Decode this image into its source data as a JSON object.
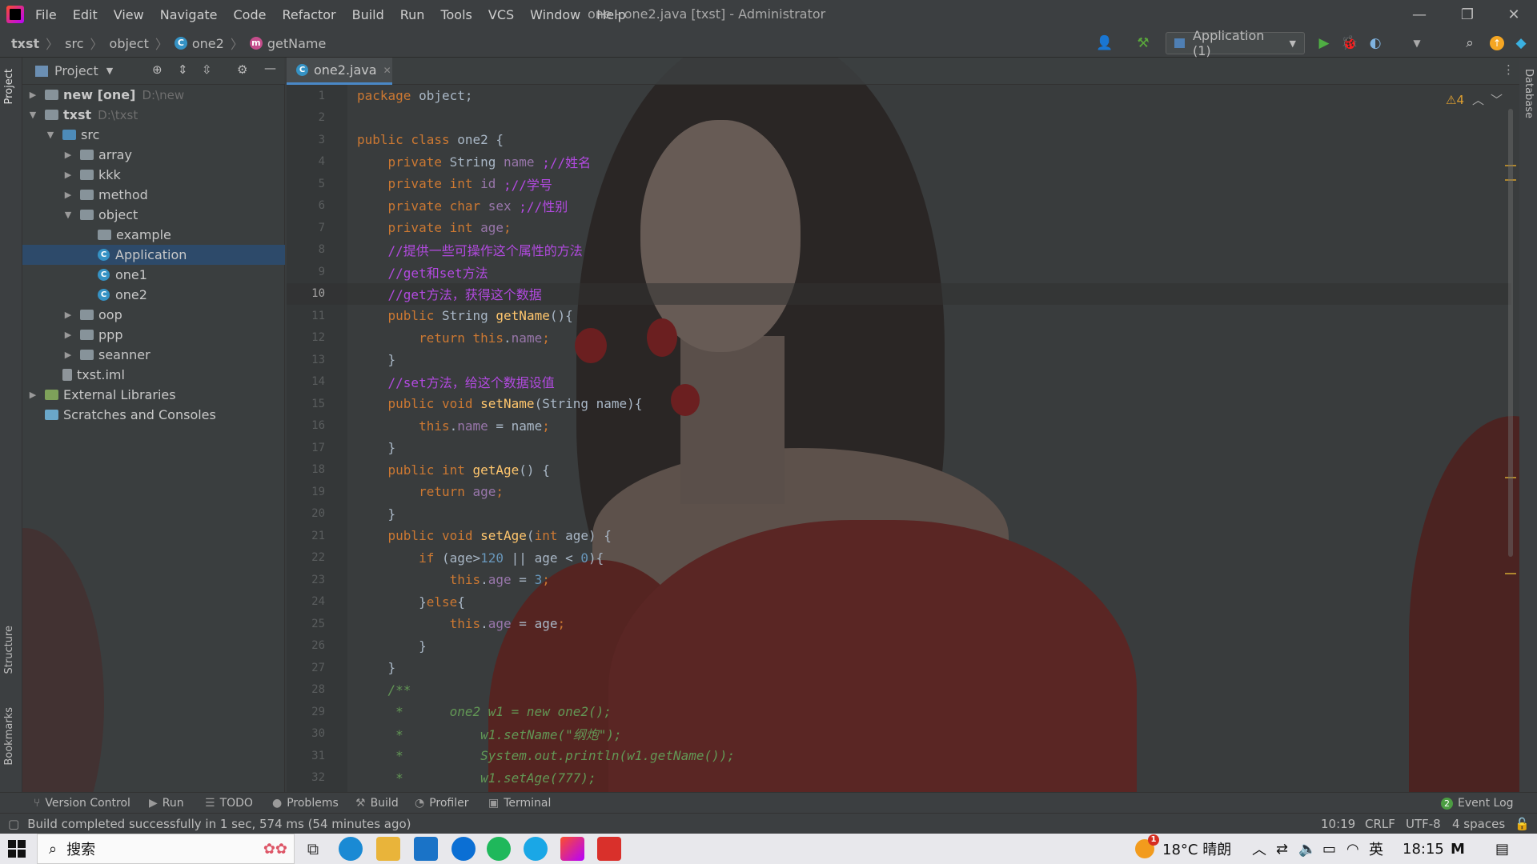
{
  "window": {
    "menu": [
      "File",
      "Edit",
      "View",
      "Navigate",
      "Code",
      "Refactor",
      "Build",
      "Run",
      "Tools",
      "VCS",
      "Window",
      "Help"
    ],
    "title": "one - one2.java [txst] - Administrator"
  },
  "breadcrumb": [
    "txst",
    "src",
    "object",
    "one2",
    "getName"
  ],
  "run_config": "Application (1)",
  "project_panel": {
    "title": "Project",
    "tree": [
      {
        "label": "new [one]",
        "hint": "D:\\new",
        "depth": 0,
        "arrow": "right",
        "icon": "folder"
      },
      {
        "label": "txst",
        "hint": "D:\\txst",
        "depth": 0,
        "arrow": "down",
        "icon": "folder"
      },
      {
        "label": "src",
        "hint": "",
        "depth": 1,
        "arrow": "down",
        "icon": "src"
      },
      {
        "label": "array",
        "hint": "",
        "depth": 2,
        "arrow": "right",
        "icon": "folder"
      },
      {
        "label": "kkk",
        "hint": "",
        "depth": 2,
        "arrow": "right",
        "icon": "folder"
      },
      {
        "label": "method",
        "hint": "",
        "depth": 2,
        "arrow": "right",
        "icon": "folder"
      },
      {
        "label": "object",
        "hint": "",
        "depth": 2,
        "arrow": "down",
        "icon": "folder"
      },
      {
        "label": "example",
        "hint": "",
        "depth": 3,
        "arrow": "",
        "icon": "folder"
      },
      {
        "label": "Application",
        "hint": "",
        "depth": 3,
        "arrow": "",
        "icon": "class",
        "selected": true
      },
      {
        "label": "one1",
        "hint": "",
        "depth": 3,
        "arrow": "",
        "icon": "class"
      },
      {
        "label": "one2",
        "hint": "",
        "depth": 3,
        "arrow": "",
        "icon": "class"
      },
      {
        "label": "oop",
        "hint": "",
        "depth": 2,
        "arrow": "right",
        "icon": "folder"
      },
      {
        "label": "ppp",
        "hint": "",
        "depth": 2,
        "arrow": "right",
        "icon": "folder"
      },
      {
        "label": "seanner",
        "hint": "",
        "depth": 2,
        "arrow": "right",
        "icon": "folder"
      },
      {
        "label": "txst.iml",
        "hint": "",
        "depth": 1,
        "arrow": "",
        "icon": "file"
      },
      {
        "label": "External Libraries",
        "hint": "",
        "depth": 0,
        "arrow": "right",
        "icon": "lib"
      },
      {
        "label": "Scratches and Consoles",
        "hint": "",
        "depth": 0,
        "arrow": "",
        "icon": "scratch"
      }
    ]
  },
  "editor": {
    "tab": "one2.java",
    "warnings": "4",
    "current_line": 10,
    "lines": [
      {
        "n": 1,
        "tokens": [
          [
            "kw",
            "package "
          ],
          [
            "txt",
            "object;"
          ]
        ]
      },
      {
        "n": 2,
        "tokens": []
      },
      {
        "n": 3,
        "tokens": [
          [
            "kw",
            "public class "
          ],
          [
            "txt",
            "one2 {"
          ]
        ]
      },
      {
        "n": 4,
        "tokens": [
          [
            "txt",
            "    "
          ],
          [
            "kw",
            "private "
          ],
          [
            "txt",
            "String "
          ],
          [
            "fd",
            "name "
          ],
          [
            "cm",
            ";//姓名"
          ]
        ]
      },
      {
        "n": 5,
        "tokens": [
          [
            "txt",
            "    "
          ],
          [
            "kw",
            "private int "
          ],
          [
            "fd",
            "id "
          ],
          [
            "cm",
            ";//学号"
          ]
        ]
      },
      {
        "n": 6,
        "tokens": [
          [
            "txt",
            "    "
          ],
          [
            "kw",
            "private char "
          ],
          [
            "fd",
            "sex "
          ],
          [
            "cm",
            ";//性别"
          ]
        ]
      },
      {
        "n": 7,
        "tokens": [
          [
            "txt",
            "    "
          ],
          [
            "kw",
            "private int "
          ],
          [
            "fd",
            "age"
          ],
          [
            "kw",
            ";"
          ]
        ]
      },
      {
        "n": 8,
        "tokens": [
          [
            "txt",
            "    "
          ],
          [
            "cm",
            "//提供一些可操作这个属性的方法"
          ]
        ]
      },
      {
        "n": 9,
        "tokens": [
          [
            "txt",
            "    "
          ],
          [
            "cm",
            "//get和set方法"
          ]
        ]
      },
      {
        "n": 10,
        "tokens": [
          [
            "txt",
            "    "
          ],
          [
            "cm",
            "//get方法，获得这个数据"
          ]
        ]
      },
      {
        "n": 11,
        "tokens": [
          [
            "txt",
            "    "
          ],
          [
            "kw",
            "public "
          ],
          [
            "txt",
            "String "
          ],
          [
            "fn",
            "getName"
          ],
          [
            "txt",
            "(){"
          ]
        ]
      },
      {
        "n": 12,
        "tokens": [
          [
            "txt",
            "        "
          ],
          [
            "kw",
            "return this"
          ],
          [
            "txt",
            "."
          ],
          [
            "fd",
            "name"
          ],
          [
            "kw",
            ";"
          ]
        ]
      },
      {
        "n": 13,
        "tokens": [
          [
            "txt",
            "    }"
          ]
        ]
      },
      {
        "n": 14,
        "tokens": [
          [
            "txt",
            "    "
          ],
          [
            "cm",
            "//set方法，给这个数据设值"
          ]
        ]
      },
      {
        "n": 15,
        "tokens": [
          [
            "txt",
            "    "
          ],
          [
            "kw",
            "public void "
          ],
          [
            "fn",
            "setName"
          ],
          [
            "txt",
            "(String name){"
          ]
        ]
      },
      {
        "n": 16,
        "tokens": [
          [
            "txt",
            "        "
          ],
          [
            "kw",
            "this"
          ],
          [
            "txt",
            "."
          ],
          [
            "fd",
            "name"
          ],
          [
            "txt",
            " = name"
          ],
          [
            "kw",
            ";"
          ]
        ]
      },
      {
        "n": 17,
        "tokens": [
          [
            "txt",
            "    }"
          ]
        ]
      },
      {
        "n": 18,
        "tokens": [
          [
            "txt",
            "    "
          ],
          [
            "kw",
            "public int "
          ],
          [
            "fn",
            "getAge"
          ],
          [
            "txt",
            "() {"
          ]
        ]
      },
      {
        "n": 19,
        "tokens": [
          [
            "txt",
            "        "
          ],
          [
            "kw",
            "return "
          ],
          [
            "fd",
            "age"
          ],
          [
            "kw",
            ";"
          ]
        ]
      },
      {
        "n": 20,
        "tokens": [
          [
            "txt",
            "    }"
          ]
        ]
      },
      {
        "n": 21,
        "tokens": [
          [
            "txt",
            "    "
          ],
          [
            "kw",
            "public void "
          ],
          [
            "fn",
            "setAge"
          ],
          [
            "txt",
            "("
          ],
          [
            "kw",
            "int "
          ],
          [
            "txt",
            "age) {"
          ]
        ]
      },
      {
        "n": 22,
        "tokens": [
          [
            "txt",
            "        "
          ],
          [
            "kw",
            "if "
          ],
          [
            "txt",
            "(age>"
          ],
          [
            "num",
            "120 "
          ],
          [
            "txt",
            "|| age < "
          ],
          [
            "num",
            "0"
          ],
          [
            "txt",
            "){"
          ]
        ]
      },
      {
        "n": 23,
        "tokens": [
          [
            "txt",
            "            "
          ],
          [
            "kw",
            "this"
          ],
          [
            "txt",
            "."
          ],
          [
            "fd",
            "age "
          ],
          [
            "txt",
            "= "
          ],
          [
            "num",
            "3"
          ],
          [
            "kw",
            ";"
          ]
        ]
      },
      {
        "n": 24,
        "tokens": [
          [
            "txt",
            "        }"
          ],
          [
            "kw",
            "else"
          ],
          [
            "txt",
            "{"
          ]
        ]
      },
      {
        "n": 25,
        "tokens": [
          [
            "txt",
            "            "
          ],
          [
            "kw",
            "this"
          ],
          [
            "txt",
            "."
          ],
          [
            "fd",
            "age "
          ],
          [
            "txt",
            "= age"
          ],
          [
            "kw",
            ";"
          ]
        ]
      },
      {
        "n": 26,
        "tokens": [
          [
            "txt",
            "        }"
          ]
        ]
      },
      {
        "n": 27,
        "tokens": [
          [
            "txt",
            "    }"
          ]
        ]
      },
      {
        "n": 28,
        "tokens": [
          [
            "txt",
            "    "
          ],
          [
            "doc",
            "/**"
          ]
        ]
      },
      {
        "n": 29,
        "tokens": [
          [
            "doc",
            "     *      one2 w1 = new one2();"
          ]
        ]
      },
      {
        "n": 30,
        "tokens": [
          [
            "doc",
            "     *          w1.setName(\"纲炮\");"
          ]
        ]
      },
      {
        "n": 31,
        "tokens": [
          [
            "doc",
            "     *          System.out.println(w1.getName());"
          ]
        ]
      },
      {
        "n": 32,
        "tokens": [
          [
            "doc",
            "     *          w1.setAge(777);"
          ]
        ]
      }
    ]
  },
  "tool_windows": [
    "Version Control",
    "Run",
    "TODO",
    "Problems",
    "Build",
    "Profiler",
    "Terminal"
  ],
  "event_log": {
    "count": "2",
    "label": "Event Log"
  },
  "status": {
    "message": "Build completed successfully in 1 sec, 574 ms (54 minutes ago)",
    "position": "10:19",
    "line_sep": "CRLF",
    "encoding": "UTF-8",
    "indent": "4 spaces"
  },
  "side_labels": {
    "project": "Project",
    "structure": "Structure",
    "bookmarks": "Bookmarks",
    "database": "Database"
  },
  "taskbar": {
    "search": "搜索",
    "weather": "18°C 晴朗",
    "ime": "英",
    "time": "18:15",
    "notify_badge": "1"
  }
}
